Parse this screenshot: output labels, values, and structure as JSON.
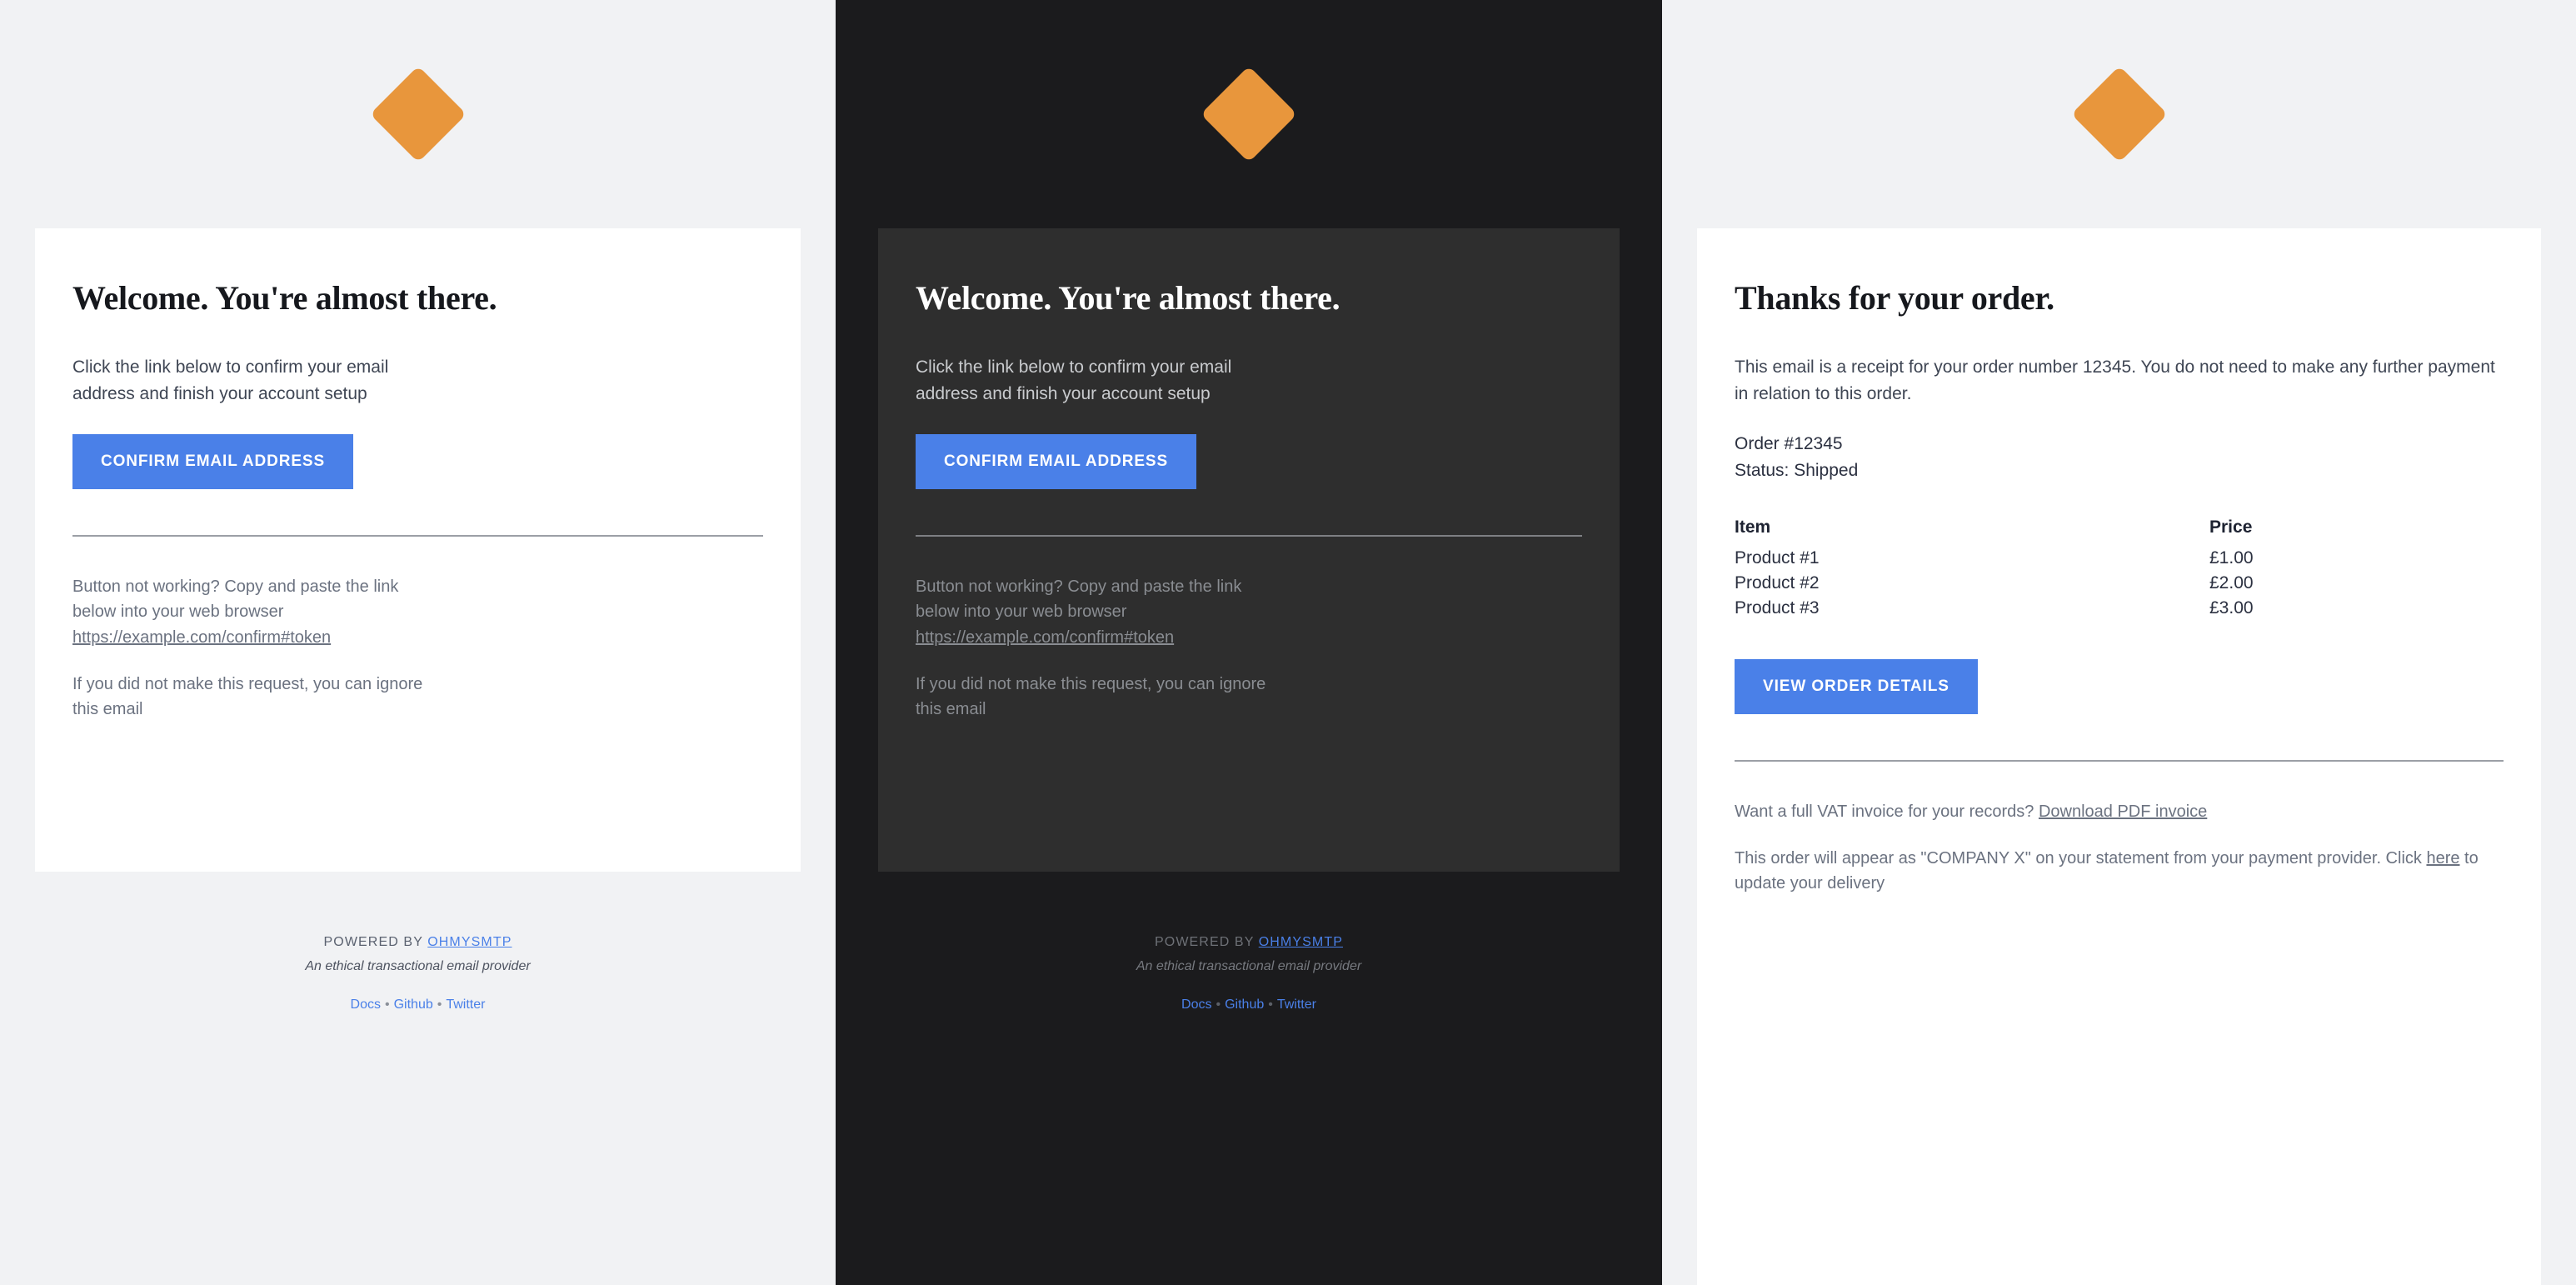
{
  "brand": {
    "logo_icon": "orange-diamond-logo",
    "accent_color": "#e8963c",
    "button_color": "#4a80e8",
    "link_color": "#4a80e8"
  },
  "footer": {
    "powered_prefix": "POWERED BY ",
    "brand_name": "OHMYSMTP",
    "tagline": "An ethical transactional email provider",
    "separator": "•",
    "links": [
      {
        "label": "Docs"
      },
      {
        "label": "Github"
      },
      {
        "label": "Twitter"
      }
    ]
  },
  "panels": [
    {
      "theme": "light",
      "headline": "Welcome. You're almost there.",
      "intro": "Click the link below to confirm your email address and finish your account setup",
      "cta_label": "CONFIRM EMAIL ADDRESS",
      "fallback_prefix": "Button not working? Copy and paste the link below into your web browser ",
      "fallback_link": "https://example.com/confirm#token",
      "ignore_note": "If you did not make this request, you can ignore this email"
    },
    {
      "theme": "dark",
      "headline": "Welcome. You're almost there.",
      "intro": "Click the link below to confirm your email address and finish your account setup",
      "cta_label": "CONFIRM EMAIL ADDRESS",
      "fallback_prefix": "Button not working? Copy and paste the link below into your web browser ",
      "fallback_link": "https://example.com/confirm#token",
      "ignore_note": "If you did not make this request, you can ignore this email"
    }
  ],
  "receipt": {
    "headline": "Thanks for your order.",
    "intro": "This email is a receipt for your order number 12345. You do not need to make any further payment in relation to this order.",
    "order_line": "Order #12345",
    "status_line": "Status: Shipped",
    "table": {
      "headers": [
        "Item",
        "Price"
      ],
      "rows": [
        {
          "item": "Product #1",
          "price": "£1.00"
        },
        {
          "item": "Product #2",
          "price": "£2.00"
        },
        {
          "item": "Product #3",
          "price": "£3.00"
        }
      ]
    },
    "cta_label": "VIEW ORDER DETAILS",
    "vat_prefix": "Want a full VAT invoice for your records? ",
    "vat_link": "Download PDF invoice",
    "statement_prefix": "This order will appear as \"COMPANY X\" on your statement from your payment provider. Click ",
    "statement_link": "here",
    "statement_suffix": " to update your delivery"
  }
}
